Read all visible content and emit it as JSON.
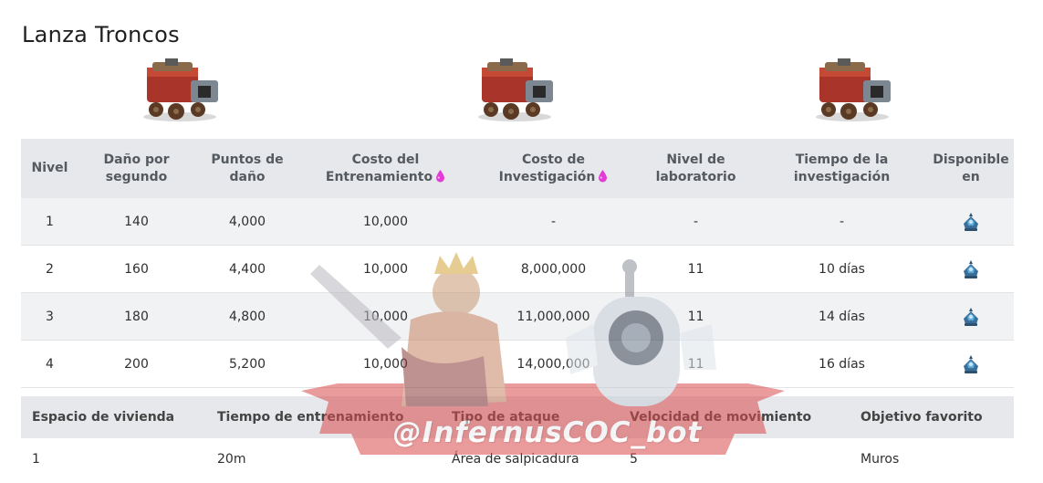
{
  "page": {
    "title": "Lanza Troncos"
  },
  "unit_images": [
    {
      "icon": "log-launcher-icon",
      "alt": "Lanza Troncos"
    },
    {
      "icon": "log-launcher-icon",
      "alt": "Lanza Troncos"
    },
    {
      "icon": "log-launcher-icon",
      "alt": "Lanza Troncos"
    }
  ],
  "levels_table": {
    "headers": [
      {
        "line1": "Nivel",
        "line2": ""
      },
      {
        "line1": "Daño por",
        "line2": "segundo"
      },
      {
        "line1": "Puntos de",
        "line2": "daño"
      },
      {
        "line1": "Costo del",
        "line2": "Entrenamiento",
        "icon": "elixir-icon"
      },
      {
        "line1": "Costo de",
        "line2": "Investigación",
        "icon": "elixir-icon"
      },
      {
        "line1": "Nivel de",
        "line2": "laboratorio"
      },
      {
        "line1": "Tiempo de la",
        "line2": "investigación"
      },
      {
        "line1": "Disponible",
        "line2": "en"
      }
    ],
    "rows": [
      {
        "level": "1",
        "dps": "140",
        "damage": "4,000",
        "training_cost": "10,000",
        "research_cost": "-",
        "lab_level": "-",
        "research_time": "-",
        "available": "town-hall-icon"
      },
      {
        "level": "2",
        "dps": "160",
        "damage": "4,400",
        "training_cost": "10,000",
        "research_cost": "8,000,000",
        "lab_level": "11",
        "research_time": "10 días",
        "available": "town-hall-icon"
      },
      {
        "level": "3",
        "dps": "180",
        "damage": "4,800",
        "training_cost": "10,000",
        "research_cost": "11,000,000",
        "lab_level": "11",
        "research_time": "14 días",
        "available": "town-hall-icon"
      },
      {
        "level": "4",
        "dps": "200",
        "damage": "5,200",
        "training_cost": "10,000",
        "research_cost": "14,000,000",
        "lab_level": "11",
        "research_time": "16 días",
        "available": "town-hall-icon"
      }
    ]
  },
  "stats_table": {
    "headers": [
      "Espacio de vivienda",
      "Tiempo de entrenamiento",
      "Tipo de ataque",
      "Velocidad de movimiento",
      "Objetivo favorito"
    ],
    "values": [
      "1",
      "20m",
      "Área de salpicadura",
      "5",
      "Muros"
    ]
  },
  "watermark": {
    "text": "@InfernusCOC_bot"
  },
  "colors": {
    "header_bg": "#e6e8eb",
    "alt_row_bg": "#f1f2f3",
    "elixir": "#e23bd6",
    "watermark_red": "#d94a4a"
  }
}
